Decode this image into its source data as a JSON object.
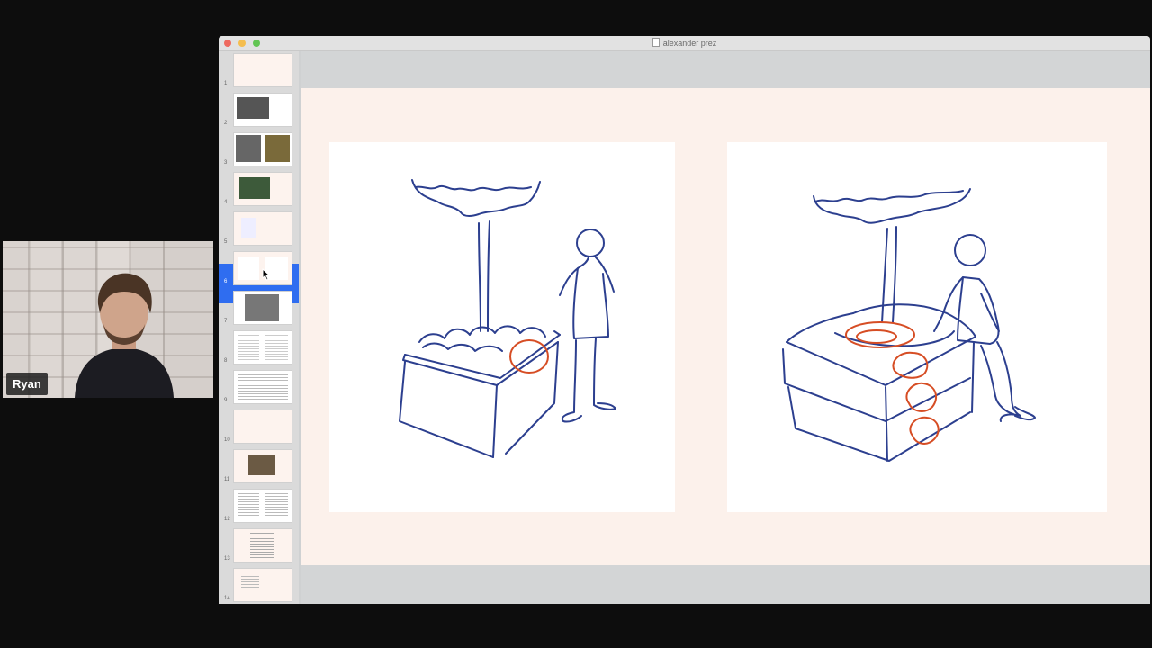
{
  "window": {
    "title": "alexander prez"
  },
  "speaker": {
    "name": "Ryan"
  },
  "slides": [
    {
      "number": "1"
    },
    {
      "number": "2"
    },
    {
      "number": "3"
    },
    {
      "number": "4"
    },
    {
      "number": "5"
    },
    {
      "number": "6"
    },
    {
      "number": "7"
    },
    {
      "number": "8"
    },
    {
      "number": "9"
    },
    {
      "number": "10"
    },
    {
      "number": "11"
    },
    {
      "number": "12"
    },
    {
      "number": "13"
    },
    {
      "number": "14"
    }
  ],
  "selected_slide": "6",
  "colors": {
    "selection": "#2f6df0",
    "ink_blue": "#2c3f8f",
    "ink_red": "#d64d24",
    "slide_bg": "#fcf1eb"
  },
  "icons": [
    "close-icon",
    "minimize-icon",
    "maximize-icon",
    "document-icon",
    "pointer-cursor-icon"
  ]
}
